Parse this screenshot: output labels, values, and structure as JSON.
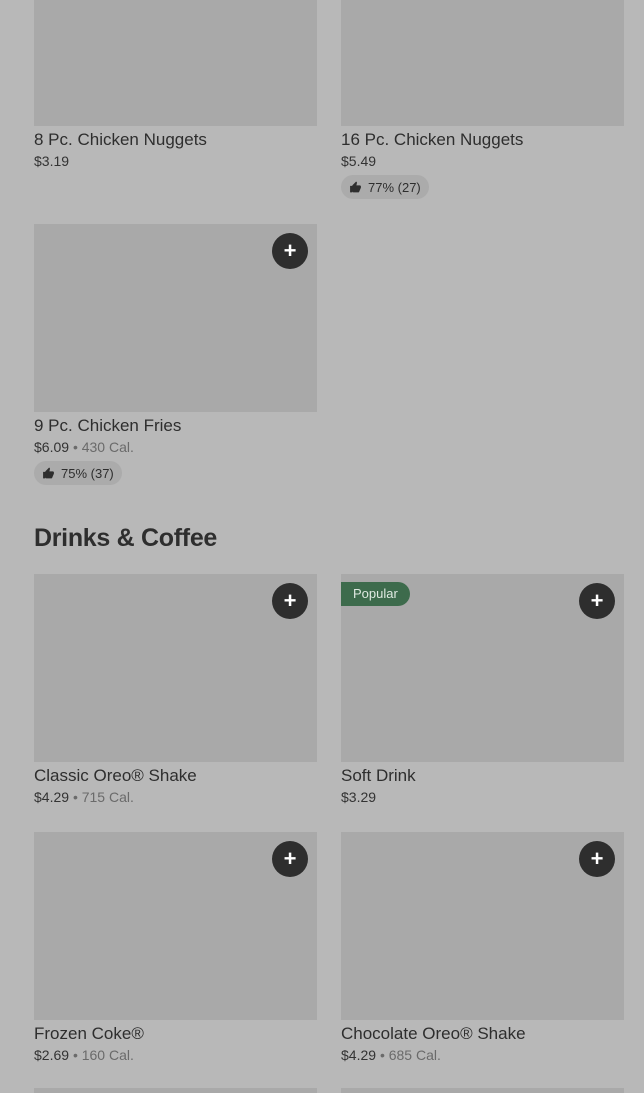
{
  "icons": {
    "add": "plus-icon",
    "rating": "thumbs-up-icon"
  },
  "colors": {
    "badge_popular": "#3d6b4c",
    "add_button": "#2e2e2e",
    "placeholder_image": "#a9a9a9"
  },
  "top_items": [
    {
      "name": "8 Pc. Chicken Nuggets",
      "price": "$3.19"
    },
    {
      "name": "16 Pc. Chicken Nuggets",
      "price": "$5.49",
      "rating": "77% (27)"
    },
    {
      "name": "9 Pc. Chicken Fries",
      "price": "$6.09",
      "separator": "•",
      "calories": "430 Cal.",
      "rating": "75% (37)",
      "add_label": "+"
    }
  ],
  "drinks_section": {
    "title": "Drinks & Coffee",
    "items": [
      {
        "name": "Classic Oreo® Shake",
        "price": "$4.29",
        "separator": "•",
        "calories": "715 Cal.",
        "add_label": "+"
      },
      {
        "name": "Soft Drink",
        "price": "$3.29",
        "badge": "Popular",
        "add_label": "+"
      },
      {
        "name": "Frozen Coke®",
        "price": "$2.69",
        "separator": "•",
        "calories": "160 Cal.",
        "add_label": "+"
      },
      {
        "name": "Chocolate Oreo® Shake",
        "price": "$4.29",
        "separator": "•",
        "calories": "685 Cal.",
        "add_label": "+"
      }
    ]
  }
}
